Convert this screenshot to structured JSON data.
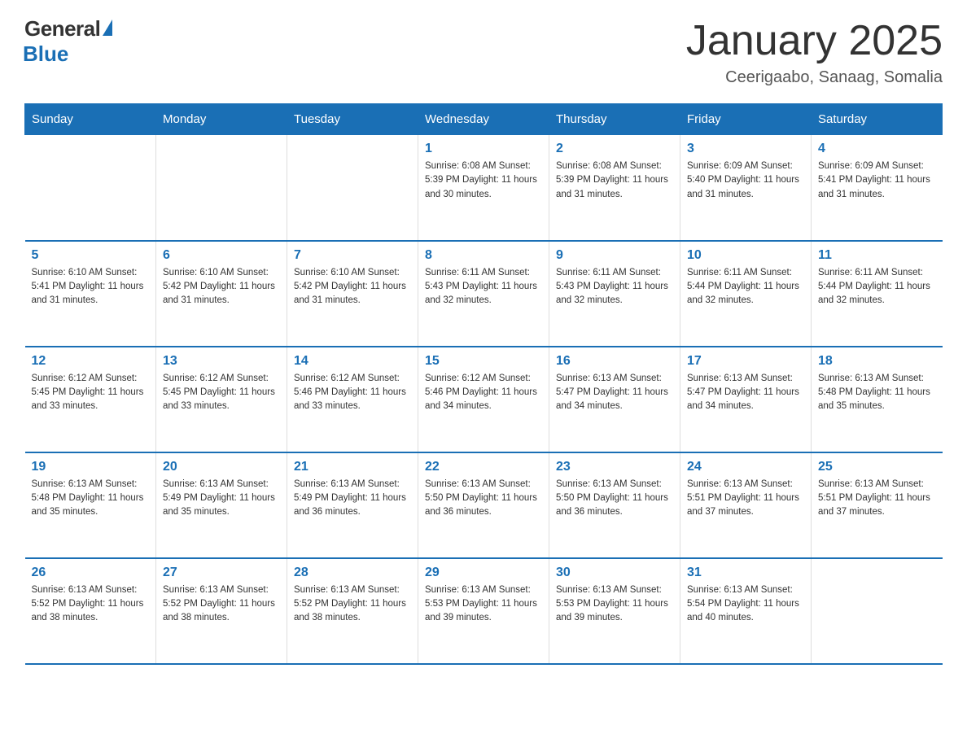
{
  "logo": {
    "general": "General",
    "blue": "Blue"
  },
  "title": "January 2025",
  "subtitle": "Ceerigaabo, Sanaag, Somalia",
  "days_of_week": [
    "Sunday",
    "Monday",
    "Tuesday",
    "Wednesday",
    "Thursday",
    "Friday",
    "Saturday"
  ],
  "weeks": [
    [
      {
        "day": "",
        "info": ""
      },
      {
        "day": "",
        "info": ""
      },
      {
        "day": "",
        "info": ""
      },
      {
        "day": "1",
        "info": "Sunrise: 6:08 AM\nSunset: 5:39 PM\nDaylight: 11 hours and 30 minutes."
      },
      {
        "day": "2",
        "info": "Sunrise: 6:08 AM\nSunset: 5:39 PM\nDaylight: 11 hours and 31 minutes."
      },
      {
        "day": "3",
        "info": "Sunrise: 6:09 AM\nSunset: 5:40 PM\nDaylight: 11 hours and 31 minutes."
      },
      {
        "day": "4",
        "info": "Sunrise: 6:09 AM\nSunset: 5:41 PM\nDaylight: 11 hours and 31 minutes."
      }
    ],
    [
      {
        "day": "5",
        "info": "Sunrise: 6:10 AM\nSunset: 5:41 PM\nDaylight: 11 hours and 31 minutes."
      },
      {
        "day": "6",
        "info": "Sunrise: 6:10 AM\nSunset: 5:42 PM\nDaylight: 11 hours and 31 minutes."
      },
      {
        "day": "7",
        "info": "Sunrise: 6:10 AM\nSunset: 5:42 PM\nDaylight: 11 hours and 31 minutes."
      },
      {
        "day": "8",
        "info": "Sunrise: 6:11 AM\nSunset: 5:43 PM\nDaylight: 11 hours and 32 minutes."
      },
      {
        "day": "9",
        "info": "Sunrise: 6:11 AM\nSunset: 5:43 PM\nDaylight: 11 hours and 32 minutes."
      },
      {
        "day": "10",
        "info": "Sunrise: 6:11 AM\nSunset: 5:44 PM\nDaylight: 11 hours and 32 minutes."
      },
      {
        "day": "11",
        "info": "Sunrise: 6:11 AM\nSunset: 5:44 PM\nDaylight: 11 hours and 32 minutes."
      }
    ],
    [
      {
        "day": "12",
        "info": "Sunrise: 6:12 AM\nSunset: 5:45 PM\nDaylight: 11 hours and 33 minutes."
      },
      {
        "day": "13",
        "info": "Sunrise: 6:12 AM\nSunset: 5:45 PM\nDaylight: 11 hours and 33 minutes."
      },
      {
        "day": "14",
        "info": "Sunrise: 6:12 AM\nSunset: 5:46 PM\nDaylight: 11 hours and 33 minutes."
      },
      {
        "day": "15",
        "info": "Sunrise: 6:12 AM\nSunset: 5:46 PM\nDaylight: 11 hours and 34 minutes."
      },
      {
        "day": "16",
        "info": "Sunrise: 6:13 AM\nSunset: 5:47 PM\nDaylight: 11 hours and 34 minutes."
      },
      {
        "day": "17",
        "info": "Sunrise: 6:13 AM\nSunset: 5:47 PM\nDaylight: 11 hours and 34 minutes."
      },
      {
        "day": "18",
        "info": "Sunrise: 6:13 AM\nSunset: 5:48 PM\nDaylight: 11 hours and 35 minutes."
      }
    ],
    [
      {
        "day": "19",
        "info": "Sunrise: 6:13 AM\nSunset: 5:48 PM\nDaylight: 11 hours and 35 minutes."
      },
      {
        "day": "20",
        "info": "Sunrise: 6:13 AM\nSunset: 5:49 PM\nDaylight: 11 hours and 35 minutes."
      },
      {
        "day": "21",
        "info": "Sunrise: 6:13 AM\nSunset: 5:49 PM\nDaylight: 11 hours and 36 minutes."
      },
      {
        "day": "22",
        "info": "Sunrise: 6:13 AM\nSunset: 5:50 PM\nDaylight: 11 hours and 36 minutes."
      },
      {
        "day": "23",
        "info": "Sunrise: 6:13 AM\nSunset: 5:50 PM\nDaylight: 11 hours and 36 minutes."
      },
      {
        "day": "24",
        "info": "Sunrise: 6:13 AM\nSunset: 5:51 PM\nDaylight: 11 hours and 37 minutes."
      },
      {
        "day": "25",
        "info": "Sunrise: 6:13 AM\nSunset: 5:51 PM\nDaylight: 11 hours and 37 minutes."
      }
    ],
    [
      {
        "day": "26",
        "info": "Sunrise: 6:13 AM\nSunset: 5:52 PM\nDaylight: 11 hours and 38 minutes."
      },
      {
        "day": "27",
        "info": "Sunrise: 6:13 AM\nSunset: 5:52 PM\nDaylight: 11 hours and 38 minutes."
      },
      {
        "day": "28",
        "info": "Sunrise: 6:13 AM\nSunset: 5:52 PM\nDaylight: 11 hours and 38 minutes."
      },
      {
        "day": "29",
        "info": "Sunrise: 6:13 AM\nSunset: 5:53 PM\nDaylight: 11 hours and 39 minutes."
      },
      {
        "day": "30",
        "info": "Sunrise: 6:13 AM\nSunset: 5:53 PM\nDaylight: 11 hours and 39 minutes."
      },
      {
        "day": "31",
        "info": "Sunrise: 6:13 AM\nSunset: 5:54 PM\nDaylight: 11 hours and 40 minutes."
      },
      {
        "day": "",
        "info": ""
      }
    ]
  ]
}
